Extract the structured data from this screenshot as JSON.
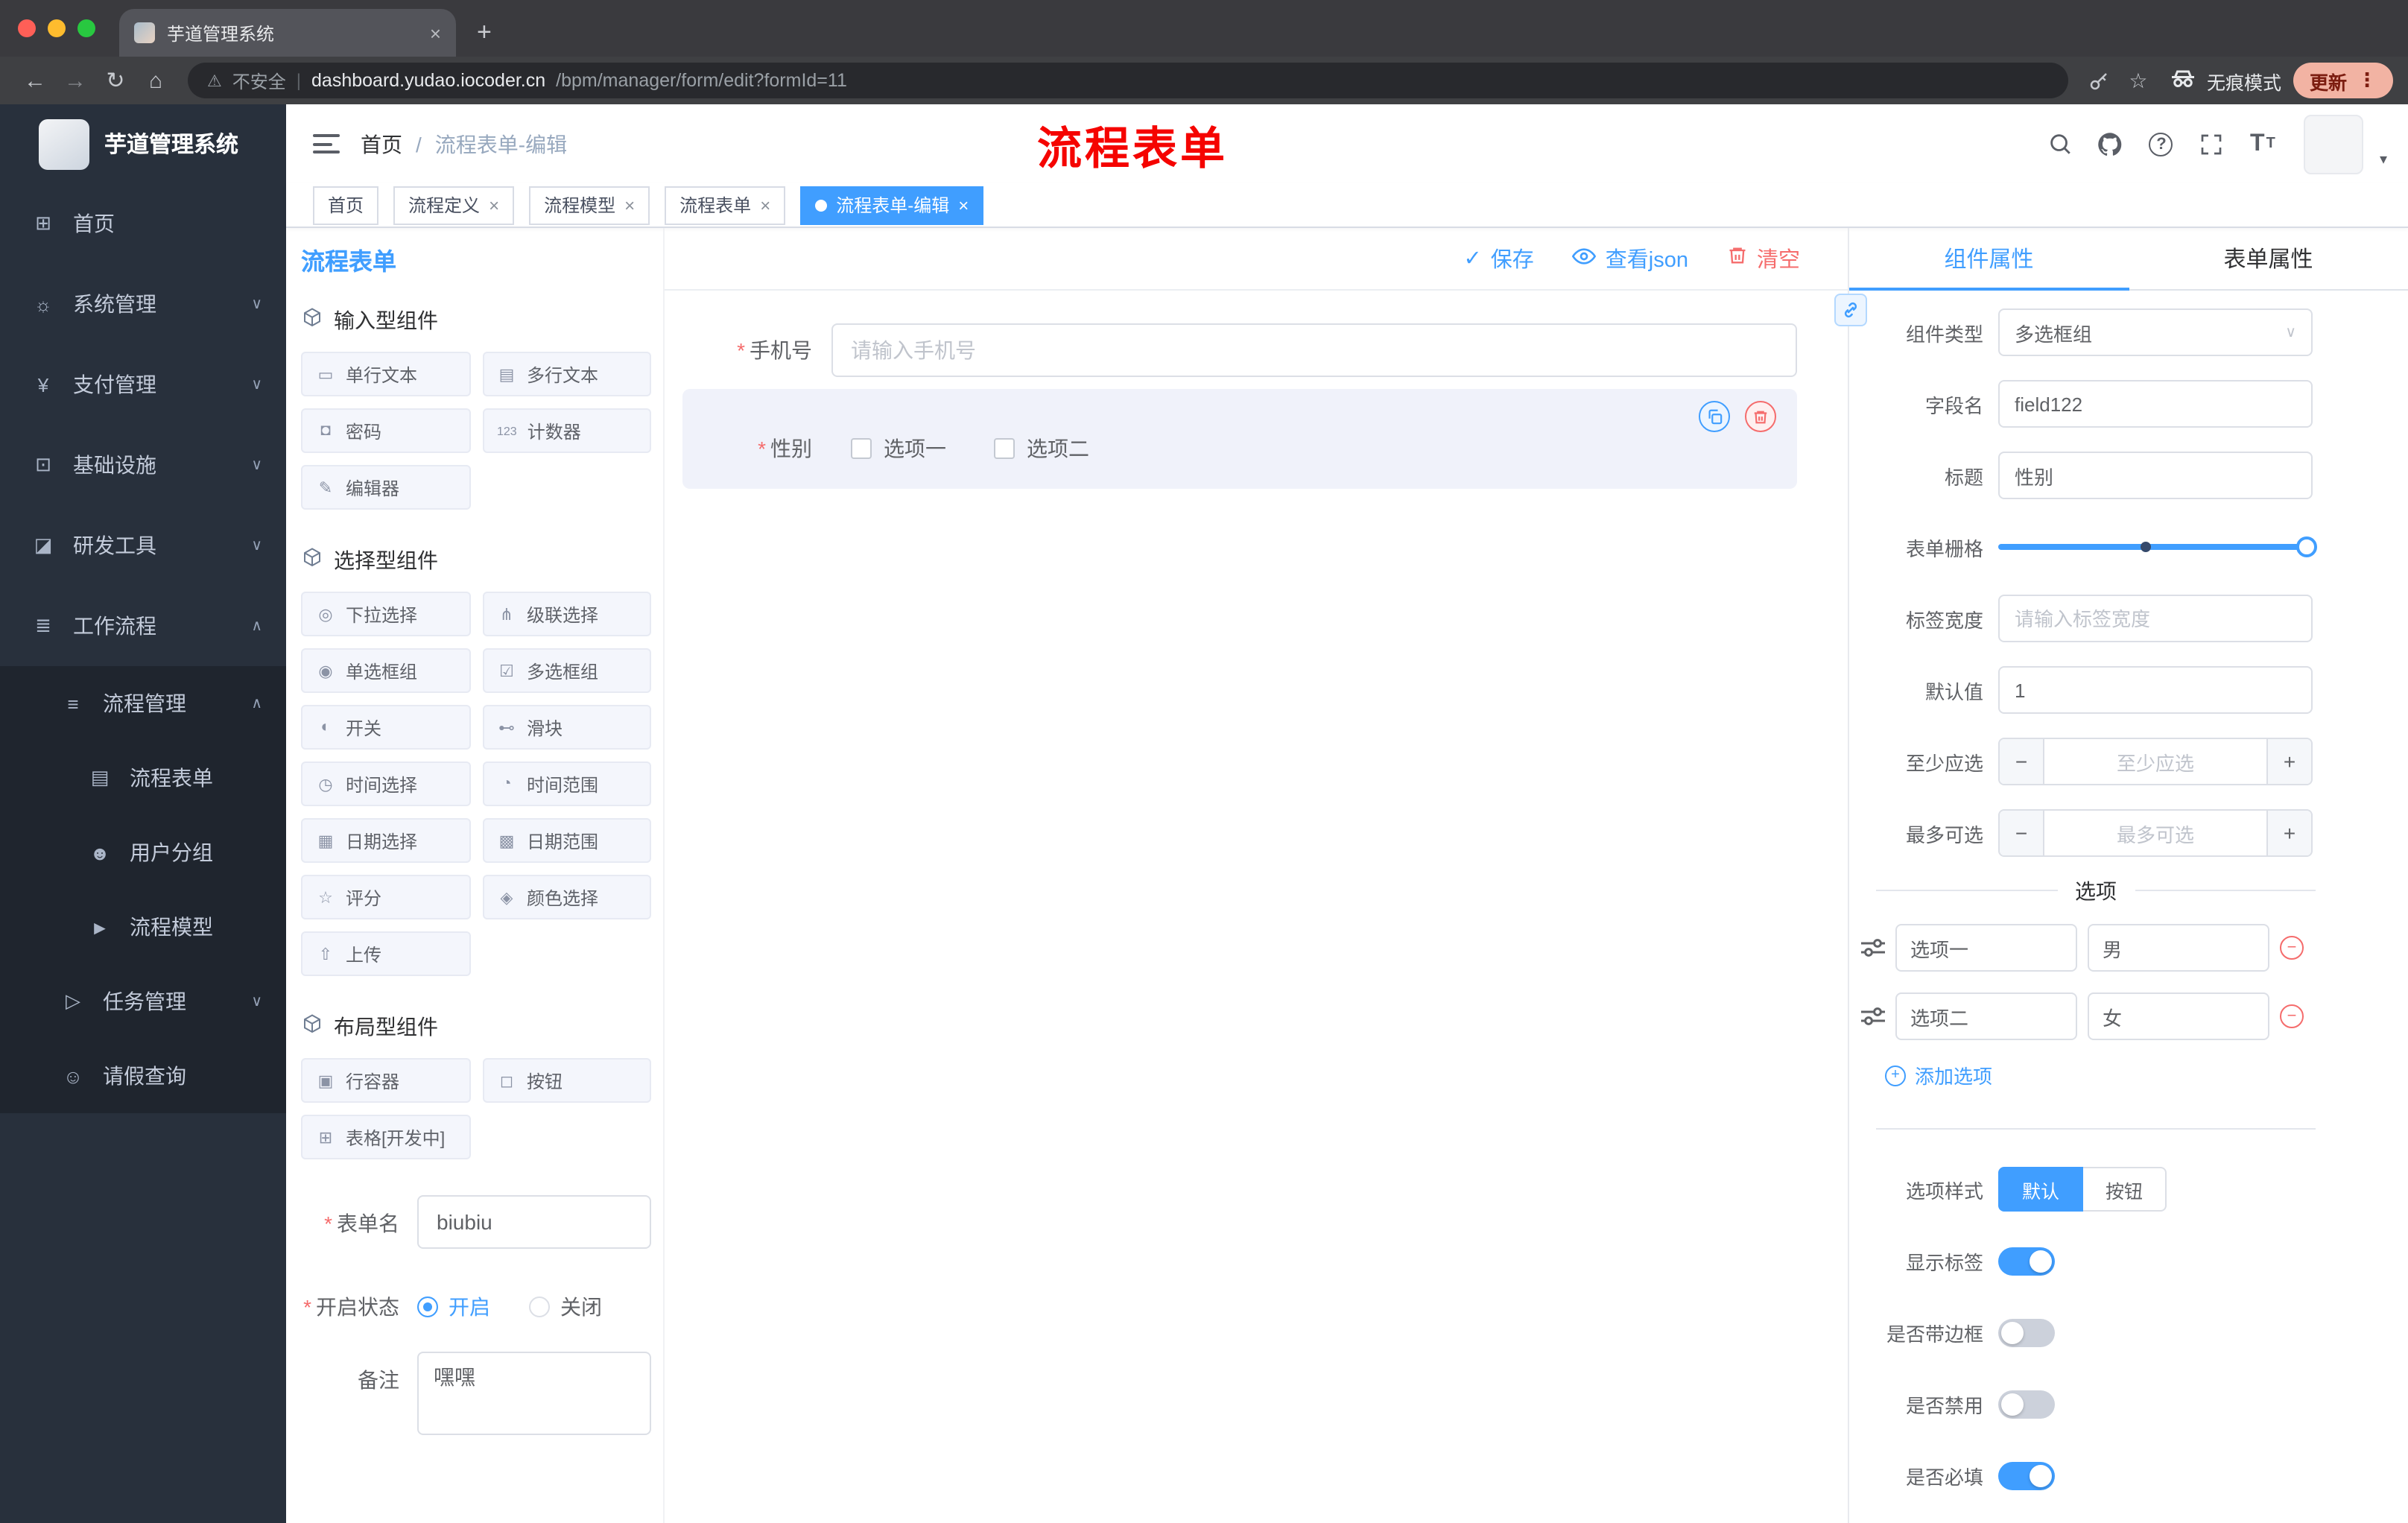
{
  "glyphs": {
    "close": "×",
    "plus": "+",
    "minus": "−",
    "back": "←",
    "forward": "→",
    "reload": "↻",
    "home": "⌂",
    "warning": "⚠",
    "star": "☆",
    "kebab": "⋮",
    "separator": "/",
    "caret_down": "∨",
    "caret_up": "∧",
    "caret_small": "▾",
    "check": "✓",
    "question": "?",
    "font_size_big": "T",
    "font_size_small": "T"
  },
  "browser": {
    "tab_title": "芋道管理系统",
    "security_label": "不安全",
    "url_host": "dashboard.yudao.iocoder.cn",
    "url_path": "/bpm/manager/form/edit?formId=11",
    "incognito_label": "无痕模式",
    "update_label": "更新"
  },
  "sidebar": {
    "logo_title": "芋道管理系统",
    "items": [
      {
        "id": "home",
        "label": "首页",
        "icon": "dashboard-icon",
        "glyph": "⊞",
        "level": 1
      },
      {
        "id": "system",
        "label": "系统管理",
        "icon": "gear-icon",
        "glyph": "☼",
        "level": 1,
        "arrow": "down"
      },
      {
        "id": "payment",
        "label": "支付管理",
        "icon": "yen-icon",
        "glyph": "¥",
        "level": 1,
        "arrow": "down"
      },
      {
        "id": "infrastructure",
        "label": "基础设施",
        "icon": "monitor-icon",
        "glyph": "⊡",
        "level": 1,
        "arrow": "down"
      },
      {
        "id": "dev-tools",
        "label": "研发工具",
        "icon": "toolbox-icon",
        "glyph": "◪",
        "level": 1,
        "arrow": "down"
      },
      {
        "id": "workflow",
        "label": "工作流程",
        "icon": "workflow-icon",
        "glyph": "≣",
        "level": 1,
        "arrow": "up"
      },
      {
        "id": "process-manage",
        "label": "流程管理",
        "icon": "list-icon",
        "glyph": "≡",
        "level": 2,
        "arrow": "up"
      },
      {
        "id": "process-form",
        "label": "流程表单",
        "icon": "document-icon",
        "glyph": "▤",
        "level": 3,
        "active": true
      },
      {
        "id": "user-group",
        "label": "用户分组",
        "icon": "group-icon",
        "glyph": "☻",
        "level": 3
      },
      {
        "id": "process-model",
        "label": "流程模型",
        "icon": "send-icon",
        "glyph": "►",
        "level": 3
      },
      {
        "id": "task-manage",
        "label": "任务管理",
        "icon": "task-icon",
        "glyph": "▷",
        "level": 2,
        "arrow": "down"
      },
      {
        "id": "leave-query",
        "label": "请假查询",
        "icon": "user-icon",
        "glyph": "☺",
        "level": 2
      }
    ]
  },
  "header": {
    "breadcrumb_home": "首页",
    "breadcrumb_current": "流程表单-编辑",
    "annotation": "流程表单"
  },
  "tags": [
    {
      "label": "首页",
      "closable": false,
      "active": false
    },
    {
      "label": "流程定义",
      "closable": true,
      "active": false
    },
    {
      "label": "流程模型",
      "closable": true,
      "active": false
    },
    {
      "label": "流程表单",
      "closable": true,
      "active": false
    },
    {
      "label": "流程表单-编辑",
      "closable": true,
      "active": true
    }
  ],
  "designer": {
    "title": "流程表单",
    "actions": {
      "save": "保存",
      "view_json": "查看json",
      "clear": "清空"
    },
    "palette": [
      {
        "title": "输入型组件",
        "items": [
          {
            "label": "单行文本",
            "icon": "single-line-text-icon",
            "glyph": "▭"
          },
          {
            "label": "多行文本",
            "icon": "multi-line-text-icon",
            "glyph": "▤"
          },
          {
            "label": "密码",
            "icon": "password-icon",
            "glyph": "◘"
          },
          {
            "label": "计数器",
            "icon": "counter-icon",
            "glyph": "123"
          },
          {
            "label": "编辑器",
            "icon": "editor-icon",
            "glyph": "✎"
          }
        ]
      },
      {
        "title": "选择型组件",
        "items": [
          {
            "label": "下拉选择",
            "icon": "select-icon",
            "glyph": "◎"
          },
          {
            "label": "级联选择",
            "icon": "cascader-icon",
            "glyph": "⋔"
          },
          {
            "label": "单选框组",
            "icon": "radio-group-icon",
            "glyph": "◉"
          },
          {
            "label": "多选框组",
            "icon": "checkbox-group-icon",
            "glyph": "☑"
          },
          {
            "label": "开关",
            "icon": "switch-icon",
            "glyph": "◐"
          },
          {
            "label": "滑块",
            "icon": "slider-icon",
            "glyph": "⊷"
          },
          {
            "label": "时间选择",
            "icon": "time-picker-icon",
            "glyph": "◷"
          },
          {
            "label": "时间范围",
            "icon": "time-range-icon",
            "glyph": "◔"
          },
          {
            "label": "日期选择",
            "icon": "date-picker-icon",
            "glyph": "▦"
          },
          {
            "label": "日期范围",
            "icon": "date-range-icon",
            "glyph": "▩"
          },
          {
            "label": "评分",
            "icon": "rate-icon",
            "glyph": "☆"
          },
          {
            "label": "颜色选择",
            "icon": "color-picker-icon",
            "glyph": "◈"
          },
          {
            "label": "上传",
            "icon": "upload-icon",
            "glyph": "⇧"
          }
        ]
      },
      {
        "title": "布局型组件",
        "items": [
          {
            "label": "行容器",
            "icon": "row-container-icon",
            "glyph": "▣"
          },
          {
            "label": "按钮",
            "icon": "button-icon",
            "glyph": "◻"
          },
          {
            "label": "表格[开发中]",
            "icon": "table-icon",
            "glyph": "⊞"
          }
        ]
      }
    ],
    "form_meta": {
      "name_label": "表单名",
      "name_value": "biubiu",
      "status_label": "开启状态",
      "status_options": [
        "开启",
        "关闭"
      ],
      "status_value": "开启",
      "remark_label": "备注",
      "remark_value": "嘿嘿"
    },
    "canvas": {
      "fields": [
        {
          "label": "手机号",
          "required": true,
          "placeholder": "请输入手机号"
        },
        {
          "label": "性别",
          "required": true,
          "options": [
            "选项一",
            "选项二"
          ],
          "selected": true
        }
      ]
    }
  },
  "properties": {
    "tabs": [
      "组件属性",
      "表单属性"
    ],
    "active_tab": "组件属性",
    "fields": {
      "component_type_label": "组件类型",
      "component_type_value": "多选框组",
      "field_name_label": "字段名",
      "field_name_value": "field122",
      "title_label": "标题",
      "title_value": "性别",
      "grid_label": "表单栅格",
      "label_width_label": "标签宽度",
      "label_width_placeholder": "请输入标签宽度",
      "default_label": "默认值",
      "default_value": "1",
      "min_label": "至少应选",
      "min_placeholder": "至少应选",
      "max_label": "最多可选",
      "max_placeholder": "最多可选",
      "options_divider": "选项",
      "options": [
        {
          "label": "选项一",
          "value": "男"
        },
        {
          "label": "选项二",
          "value": "女"
        }
      ],
      "add_option": "添加选项",
      "style_label": "选项样式",
      "style_options": [
        "默认",
        "按钮"
      ],
      "style_value": "默认",
      "toggles": [
        {
          "id": "show-label",
          "label": "显示标签",
          "on": true
        },
        {
          "id": "bordered",
          "label": "是否带边框",
          "on": false
        },
        {
          "id": "disabled",
          "label": "是否禁用",
          "on": false
        },
        {
          "id": "required",
          "label": "是否必填",
          "on": true
        }
      ]
    }
  },
  "colors": {
    "primary": "#409eff",
    "danger": "#f56c6c"
  }
}
